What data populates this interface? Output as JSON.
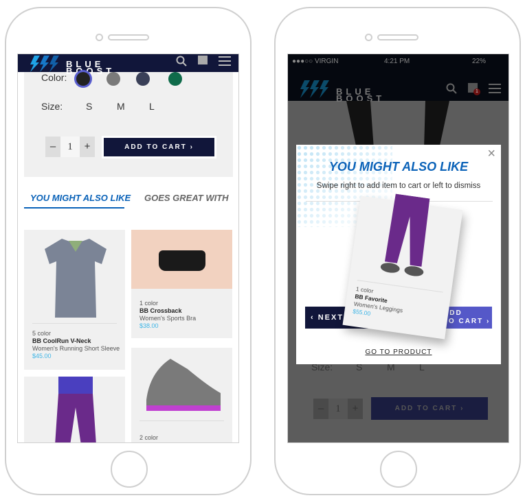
{
  "brand": {
    "name_line1": "BLUE",
    "name_line2": "BOOST"
  },
  "left": {
    "color_label": "Color:",
    "colors": [
      "#222222",
      "#7a7a7a",
      "#3a4058",
      "#0f6b4a"
    ],
    "selected_color_ring": "#5a5fd0",
    "size_label": "Size:",
    "sizes": [
      "S",
      "M",
      "L"
    ],
    "qty": {
      "minus": "–",
      "value": "1",
      "plus": "+"
    },
    "add_to_cart": "ADD TO CART ›",
    "tabs": [
      {
        "label": "YOU MIGHT ALSO LIKE",
        "active": true
      },
      {
        "label": "GOES GREAT WITH",
        "active": false
      }
    ],
    "products": [
      {
        "colors": "5 color",
        "name": "BB CoolRun V-Neck",
        "desc": "Women's Running Short Sleeve",
        "price": "$45.00"
      },
      {
        "colors": "1 color",
        "name": "BB Crossback",
        "desc": "Women's Sports Bra",
        "price": "$38.00"
      },
      {
        "colors": "2 color"
      }
    ]
  },
  "right": {
    "status": {
      "carrier": "●●●○○ VIRGIN",
      "time": "4:21 PM",
      "battery": "22%"
    },
    "cart_count": "1",
    "modal": {
      "title": "YOU MIGHT ALSO LIKE",
      "subtitle": "Swipe right to add item to cart or left to dismiss",
      "close": "×",
      "card": {
        "colors": "1 color",
        "name": "BB Favorite",
        "desc": "Women's Leggings",
        "price": "$55.00"
      },
      "next": "‹ NEXT",
      "add_line1": "ADD",
      "add_line2": "TO CART ›",
      "go": "GO TO PRODUCT"
    },
    "bg": {
      "size_label": "Size:",
      "sizes": [
        "S",
        "M",
        "L"
      ],
      "qty": "1",
      "add_to_cart": "ADD TO CART ›"
    }
  },
  "colors": {
    "navy": "#11163a",
    "accent": "#0a62b8",
    "purple": "#5558c8",
    "price": "#3cb4e6"
  }
}
